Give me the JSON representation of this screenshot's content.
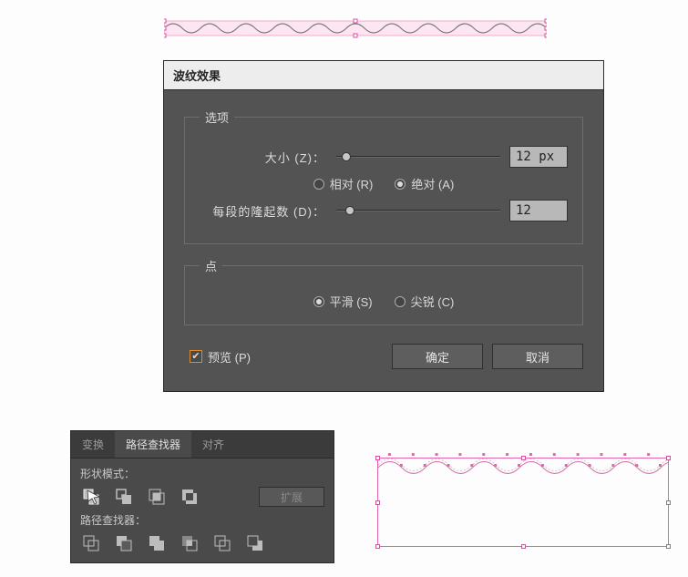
{
  "dialog": {
    "title": "波纹效果",
    "options_legend": "选项",
    "size_label": "大小 (Z)：",
    "size_value": "12 px",
    "relative_label": "相对 (R)",
    "absolute_label": "绝对 (A)",
    "size_mode": "absolute",
    "ridges_label": "每段的隆起数 (D)：",
    "ridges_value": "12",
    "points_legend": "点",
    "smooth_label": "平滑 (S)",
    "corner_label": "尖锐 (C)",
    "points_mode": "smooth",
    "preview_label": "预览 (P)",
    "preview_checked": true,
    "ok_label": "确定",
    "cancel_label": "取消"
  },
  "panel": {
    "tabs": {
      "transform": "变换",
      "pathfinder": "路径查找器",
      "align": "对齐"
    },
    "active_tab": "pathfinder",
    "shape_modes_label": "形状模式：",
    "expand_label": "扩展",
    "pathfinders_label": "路径查找器："
  }
}
